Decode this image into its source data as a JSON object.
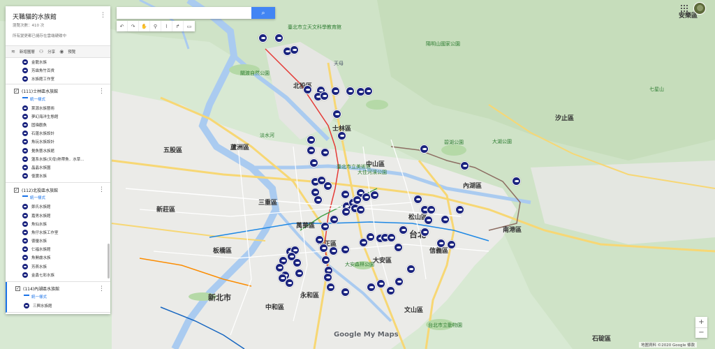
{
  "map_name": "天職貓的水族館",
  "view_count": "瀏覽次數：410 次",
  "save_note": "所有變更都已儲存在雲端硬碟中",
  "toolbar": {
    "add_layer": "新增圖層",
    "share": "分享",
    "preview": "預覽"
  },
  "top_items": [
    "金龍水族",
    "芳霖魚竹百貨",
    "水族館工作室"
  ],
  "layers": [
    {
      "title": "(111)士林區水族館",
      "style_label": "統一樣式",
      "items": [
        "萊源水族藝術",
        "夢幻海洋生態館",
        "固瑋觀魚",
        "石蓮水族設計",
        "魚玩水族設計",
        "覺魚藝水族館",
        "蓮系水族(天母)熱帶魚．水草...",
        "晶晶水族園",
        "復寶水族"
      ]
    },
    {
      "title": "(112)北投區水族館",
      "style_label": "統一樣式",
      "items": [
        "鄭氏水族館",
        "嘉男水族館",
        "魚仙水族",
        "魚仔水族工作室",
        "徳優水族",
        "仁福水族館",
        "魚開盧水族",
        "芳燕水族",
        "金鑫七彩水族"
      ]
    },
    {
      "title": "(114)內湖區水族館",
      "style_label": "統一樣式",
      "items": [
        "三興水族館"
      ]
    }
  ],
  "search": {
    "placeholder": "",
    "value": ""
  },
  "account": {
    "org_label": "安樂區"
  },
  "map_labels": {
    "nt_city": "新北市",
    "taipei": "台北",
    "lbl1": "臺北市立天文科學教育館",
    "lbl2": "北投區",
    "lbl3": "天母",
    "lbl4": "士林區",
    "lbl5": "中山區",
    "lbl6": "內湖區",
    "lbl7": "松山區",
    "lbl8": "南港區",
    "lbl9": "信義區",
    "lbl10": "大安區",
    "lbl11": "中正區",
    "lbl12": "萬華區",
    "lbl13": "板橋區",
    "lbl14": "三重區",
    "lbl15": "蘆洲區",
    "lbl16": "五股區",
    "lbl17": "新莊區",
    "lbl18": "中和區",
    "lbl19": "永和區",
    "lbl20": "文山區",
    "lbl21": "汐止區",
    "lbl22": "淡水河",
    "lbl23": "大佳河濱公園",
    "lbl24": "台北市立動物園",
    "lbl25": "陽明山國家公園",
    "lbl26": "七星山",
    "lbl27": "大湖公園",
    "lbl28": "碧湖公園",
    "lbl29": "大安森林公園",
    "lbl30": "關渡自然公園",
    "lbl31": "石碇區",
    "lbl32": "臺北市立美術館"
  },
  "logo_text": {
    "g": "Google",
    "my": " My Maps"
  },
  "attribution": "地圖資料 ©2020 Google   條款",
  "marker_color": "#1a237e",
  "zoom": {
    "in": "+",
    "out": "−"
  }
}
